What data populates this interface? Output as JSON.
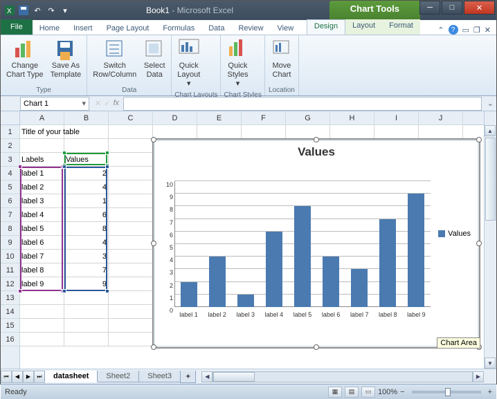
{
  "titlebar": {
    "doc": "Book1",
    "app": "Microsoft Excel",
    "context": "Chart Tools"
  },
  "tabs": {
    "file": "File",
    "list": [
      "Home",
      "Insert",
      "Page Layout",
      "Formulas",
      "Data",
      "Review",
      "View"
    ],
    "chart": [
      "Design",
      "Layout",
      "Format"
    ],
    "active_chart": "Design"
  },
  "ribbon": {
    "type": {
      "change": "Change\nChart Type",
      "save": "Save As\nTemplate",
      "label": "Type"
    },
    "data": {
      "switch": "Switch\nRow/Column",
      "select": "Select\nData",
      "label": "Data"
    },
    "layouts": {
      "quick": "Quick\nLayout",
      "label": "Chart Layouts"
    },
    "styles": {
      "quick": "Quick\nStyles",
      "label": "Chart Styles"
    },
    "location": {
      "move": "Move\nChart",
      "label": "Location"
    }
  },
  "namebox": "Chart 1",
  "fx": "fx",
  "columns": [
    "A",
    "B",
    "C",
    "D",
    "E",
    "F",
    "G",
    "H",
    "I",
    "J"
  ],
  "rows": 16,
  "table": {
    "title": "Title of your table",
    "header_labels": "Labels",
    "header_values": "Values",
    "rows": [
      {
        "label": "label 1",
        "value": 2
      },
      {
        "label": "label 2",
        "value": 4
      },
      {
        "label": "label 3",
        "value": 1
      },
      {
        "label": "label 4",
        "value": 6
      },
      {
        "label": "label 5",
        "value": 8
      },
      {
        "label": "label 6",
        "value": 4
      },
      {
        "label": "label 7",
        "value": 3
      },
      {
        "label": "label 8",
        "value": 7
      },
      {
        "label": "label 9",
        "value": 9
      }
    ]
  },
  "chart_data": {
    "type": "bar",
    "title": "Values",
    "categories": [
      "label 1",
      "label 2",
      "label 3",
      "label 4",
      "label 5",
      "label 6",
      "label 7",
      "label 8",
      "label 9"
    ],
    "values": [
      2,
      4,
      1,
      6,
      8,
      4,
      3,
      7,
      9
    ],
    "series_name": "Values",
    "ylim": [
      0,
      10
    ],
    "yticks": [
      0,
      1,
      2,
      3,
      4,
      5,
      6,
      7,
      8,
      9,
      10
    ],
    "xlabel": "",
    "ylabel": ""
  },
  "chart_tooltip": "Chart Area",
  "sheets": {
    "active": "datasheet",
    "others": [
      "Sheet2",
      "Sheet3"
    ]
  },
  "status": {
    "ready": "Ready",
    "zoom": "100%"
  }
}
